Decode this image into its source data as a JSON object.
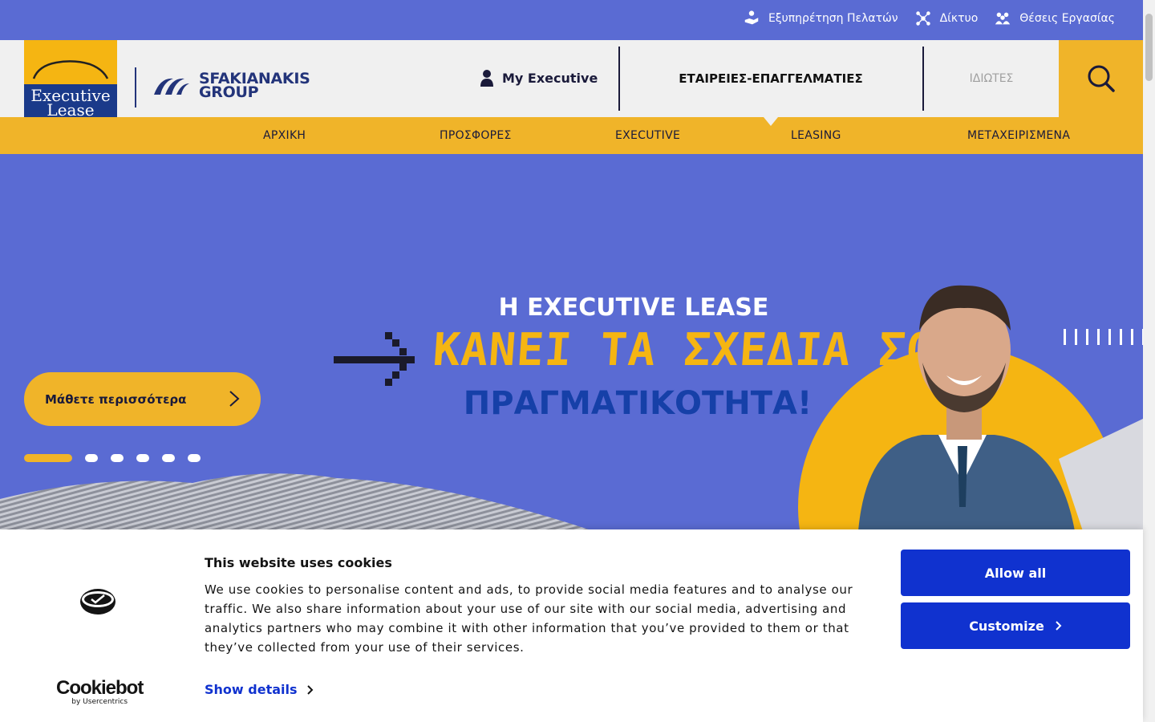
{
  "top_links": [
    {
      "label": "Εξυπηρέτηση Πελατών",
      "icon": "hand-heart-icon"
    },
    {
      "label": "Δίκτυο",
      "icon": "network-icon"
    },
    {
      "label": "Θέσεις Εργασίας",
      "icon": "people-icon"
    }
  ],
  "brand": {
    "logo_line1": "Executive",
    "logo_line2": "Lease",
    "group_line1": "SFAKIANAKIS",
    "group_line2": "GROUP"
  },
  "header": {
    "my_executive": "My Executive",
    "tab_business": "ΕΤΑΙΡΕΙΕΣ-ΕΠΑΓΓΕΛΜΑΤΙΕΣ",
    "tab_private": "ΙΔΙΩΤΕΣ"
  },
  "nav": {
    "items": [
      "ΑΡΧΙΚΗ",
      "ΠΡΟΣΦΟΡΕΣ",
      "EXECUTIVE",
      "LEASING",
      "ΜΕΤΑΧΕΙΡΙΣΜΕΝΑ"
    ]
  },
  "hero": {
    "line1": "Η EXECUTIVE LEASE",
    "line2": "ΚΑΝΕΙ ΤΑ ΣΧΕΔΙΑ ΣΟΥ",
    "line3": "ΠΡΑΓΜΑΤΙΚΟΤΗΤΑ!",
    "cta": "Μάθετε περισσότερα",
    "slides": 6,
    "active_slide": 1
  },
  "cookie": {
    "title": "This website uses cookies",
    "text": "We use cookies to personalise content and ads, to provide social media features and to analyse our traffic. We also share information about your use of our site with our social media, advertising and analytics partners who may combine it with other information that you’ve provided to them or that they’ve collected from your use of their services.",
    "show_details": "Show details",
    "allow_all": "Allow all",
    "customize": "Customize",
    "brand": "Cookiebot",
    "brand_sub": "by Usercentrics"
  },
  "colors": {
    "primary_blue": "#5a6bd3",
    "accent_yellow": "#f0b429",
    "cookie_blue": "#1032cf"
  }
}
